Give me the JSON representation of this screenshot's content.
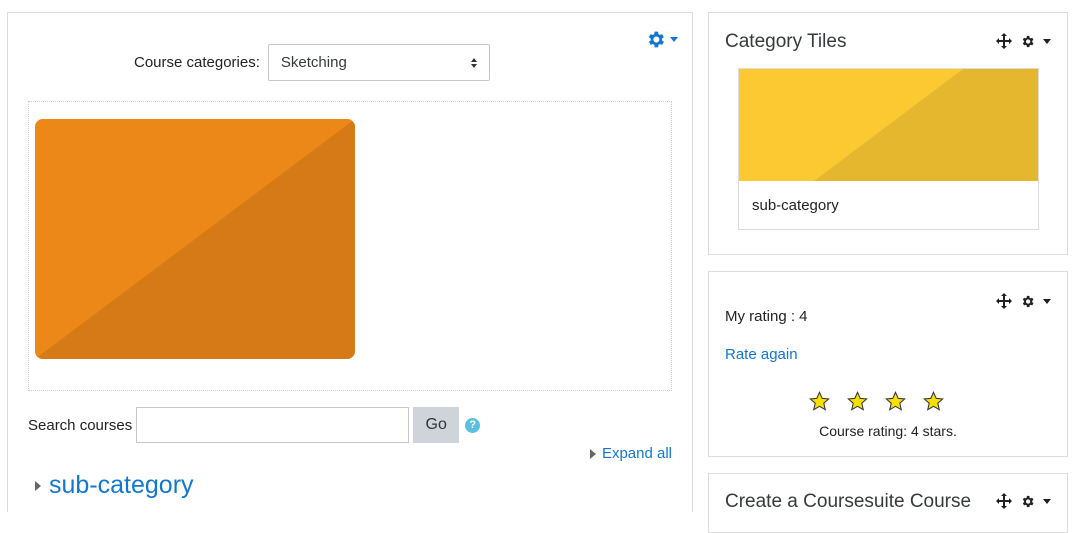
{
  "main": {
    "course_categories_label": "Course categories:",
    "selected_category": "Sketching",
    "tile_color": "#ec8818",
    "search_label": "Search courses",
    "search_value": "",
    "search_placeholder": "",
    "go_label": "Go",
    "help_glyph": "?",
    "expand_all": "Expand all",
    "subcategory_link": "sub-category"
  },
  "blocks": {
    "category_tiles": {
      "title": "Category Tiles",
      "tile_color": "#fcc932",
      "tile_label": "sub-category"
    },
    "rating": {
      "my_rating": "My rating : 4",
      "rate_again": "Rate again",
      "stars": 4,
      "course_rating": "Course rating: 4 stars."
    },
    "coursesuite": {
      "title": "Create a Coursesuite Course"
    }
  },
  "colors": {
    "link": "#1177d1",
    "star": "#f7e000"
  }
}
